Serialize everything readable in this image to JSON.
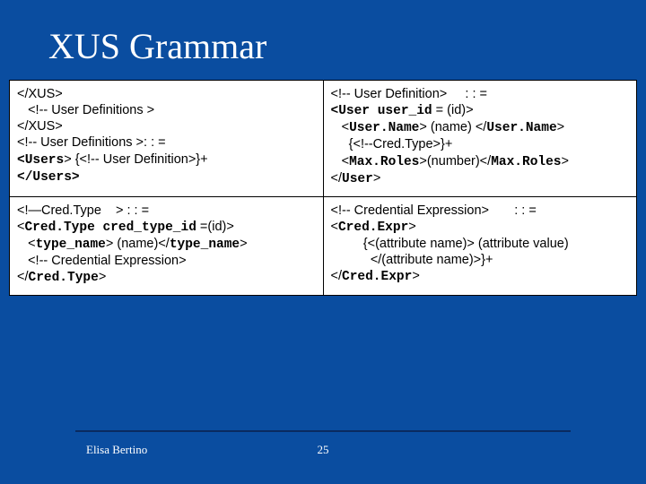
{
  "title": "XUS Grammar",
  "cells": {
    "r0c0": {
      "lines": [
        {
          "segs": [
            {
              "t": "</XUS>"
            }
          ]
        },
        {
          "segs": [
            {
              "t": "   <!-- User Definitions >"
            }
          ]
        },
        {
          "segs": [
            {
              "t": "</XUS>"
            }
          ]
        },
        {
          "segs": [
            {
              "t": ""
            }
          ]
        },
        {
          "segs": [
            {
              "t": "<!-- User Definitions >: : ="
            }
          ]
        },
        {
          "segs": [
            {
              "t": "<",
              "m": true
            },
            {
              "t": "Users",
              "m": true
            },
            {
              "t": "> {<!-- User Definition>}+"
            }
          ]
        },
        {
          "segs": [
            {
              "t": "</",
              "m": true
            },
            {
              "t": "Users",
              "m": true
            },
            {
              "t": ">",
              "m": true
            }
          ]
        }
      ]
    },
    "r0c1": {
      "lines": [
        {
          "segs": [
            {
              "t": "<!-- User Definition>     : : ="
            }
          ]
        },
        {
          "segs": [
            {
              "t": "<",
              "m": true
            },
            {
              "t": "User user_id",
              "m": true
            },
            {
              "t": " = (id)>"
            }
          ]
        },
        {
          "segs": [
            {
              "t": "   <"
            },
            {
              "t": "User.Name",
              "m": true
            },
            {
              "t": "> (name) </"
            },
            {
              "t": "User.Name",
              "m": true
            },
            {
              "t": ">"
            }
          ]
        },
        {
          "segs": [
            {
              "t": "     {<!--Cred.Type>}+"
            }
          ]
        },
        {
          "segs": [
            {
              "t": "   <"
            },
            {
              "t": "Max.Roles",
              "m": true
            },
            {
              "t": ">(number)</"
            },
            {
              "t": "Max.Roles",
              "m": true
            },
            {
              "t": ">"
            }
          ]
        },
        {
          "segs": [
            {
              "t": "</"
            },
            {
              "t": "User",
              "m": true
            },
            {
              "t": ">"
            }
          ]
        }
      ]
    },
    "r1c0": {
      "lines": [
        {
          "segs": [
            {
              "t": "<!—Cred.Type    > : : ="
            }
          ]
        },
        {
          "segs": [
            {
              "t": "<"
            },
            {
              "t": "Cred.Type cred_type_id",
              "m": true
            },
            {
              "t": " =(id)>"
            }
          ]
        },
        {
          "segs": [
            {
              "t": "   <"
            },
            {
              "t": "type_name",
              "m": true
            },
            {
              "t": "> (name)</"
            },
            {
              "t": "type_name",
              "m": true
            },
            {
              "t": ">"
            }
          ]
        },
        {
          "segs": [
            {
              "t": "   <!-- Credential Expression>"
            }
          ]
        },
        {
          "segs": [
            {
              "t": "</"
            },
            {
              "t": "Cred.Type",
              "m": true
            },
            {
              "t": ">"
            }
          ]
        }
      ]
    },
    "r1c1": {
      "lines": [
        {
          "segs": [
            {
              "t": "<!-- Credential Expression>       : : ="
            }
          ]
        },
        {
          "segs": [
            {
              "t": "<"
            },
            {
              "t": "Cred.Expr",
              "m": true
            },
            {
              "t": ">"
            }
          ]
        },
        {
          "segs": [
            {
              "t": "         {<(attribute name)> (attribute value)"
            }
          ]
        },
        {
          "segs": [
            {
              "t": "           </(attribute name)>}+"
            }
          ]
        },
        {
          "segs": [
            {
              "t": "</"
            },
            {
              "t": "Cred.Expr",
              "m": true
            },
            {
              "t": ">"
            }
          ]
        }
      ]
    }
  },
  "footer": {
    "author": "Elisa Bertino",
    "page": "25"
  }
}
